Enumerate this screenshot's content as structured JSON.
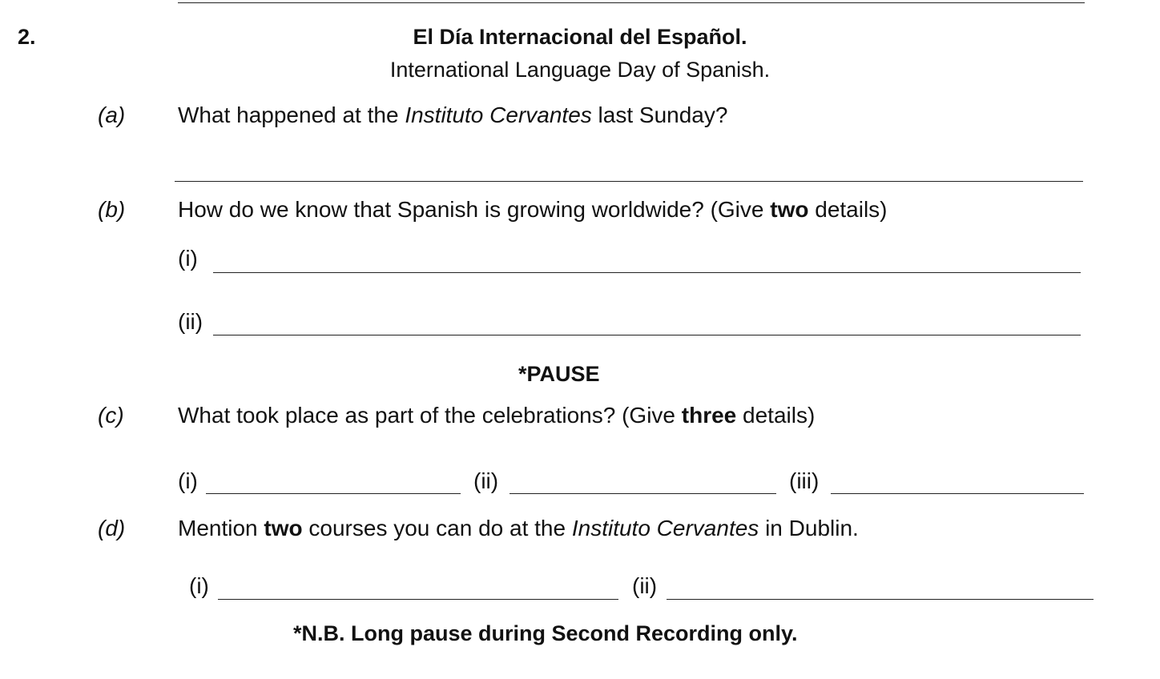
{
  "question": {
    "number": "2.",
    "title": "El Día Internacional del Español.",
    "subtitle": "International Language Day of Spanish."
  },
  "parts": {
    "a": {
      "letter": "(a)",
      "text_1": "What happened at the ",
      "text_italic": "Instituto Cervantes",
      "text_2": " last Sunday?"
    },
    "b": {
      "letter": "(b)",
      "text_1": "How do we know that Spanish is growing worldwide? (Give ",
      "text_bold": "two",
      "text_2": " details)",
      "answers": [
        "(i)",
        "(ii)"
      ]
    },
    "pause": "*PAUSE",
    "c": {
      "letter": "(c)",
      "text_1": "What took place as part of the celebrations? (Give ",
      "text_bold": "three",
      "text_2": " details)",
      "answers": [
        "(i)",
        "(ii)",
        "(iii)"
      ]
    },
    "d": {
      "letter": "(d)",
      "text_1": "Mention ",
      "text_bold": "two",
      "text_2": " courses you can do at the ",
      "text_italic": "Instituto Cervantes",
      "text_3": " in Dublin.",
      "answers": [
        "(i)",
        "(ii)"
      ]
    }
  },
  "footer_note": "*N.B. Long pause during Second Recording only."
}
